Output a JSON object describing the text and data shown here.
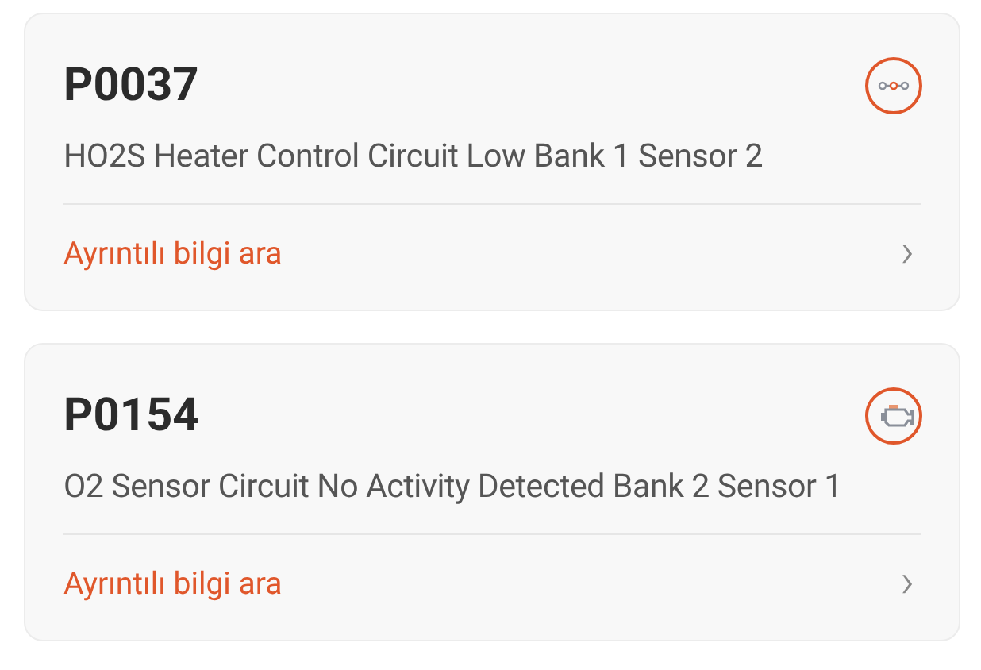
{
  "codes": [
    {
      "code": "P0037",
      "kind": "sensor",
      "description": "HO2S Heater Control Circuit Low Bank 1 Sensor 2",
      "link": "Ayrıntılı bilgi ara",
      "chevron": "›"
    },
    {
      "code": "P0154",
      "kind": "engine",
      "description": "O2 Sensor Circuit No Activity Detected Bank 2 Sensor 1",
      "link": "Ayrıntılı bilgi ara",
      "chevron": "›"
    }
  ]
}
